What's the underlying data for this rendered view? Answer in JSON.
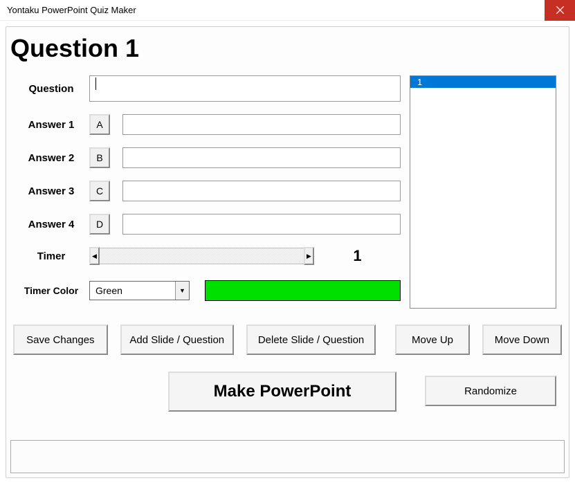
{
  "window": {
    "title": "Yontaku PowerPoint Quiz Maker"
  },
  "heading": "Question 1",
  "labels": {
    "question": "Question",
    "answer1": "Answer 1",
    "answer2": "Answer 2",
    "answer3": "Answer 3",
    "answer4": "Answer 4",
    "timer": "Timer",
    "timer_color": "Timer Color"
  },
  "letters": {
    "a": "A",
    "b": "B",
    "c": "C",
    "d": "D"
  },
  "arrows": {
    "left": "◀",
    "right": "▶",
    "down": "▼"
  },
  "values": {
    "question": "",
    "answer1": "",
    "answer2": "",
    "answer3": "",
    "answer4": "",
    "timer": "1",
    "timer_color_label": "Green",
    "timer_color_hex": "#00e000"
  },
  "list": {
    "items": [
      "1"
    ],
    "selected_index": 0
  },
  "buttons": {
    "save": "Save Changes",
    "add": "Add Slide / Question",
    "delete": "Delete Slide / Question",
    "move_up": "Move Up",
    "move_down": "Move Down",
    "make": "Make PowerPoint",
    "randomize": "Randomize"
  },
  "status": ""
}
